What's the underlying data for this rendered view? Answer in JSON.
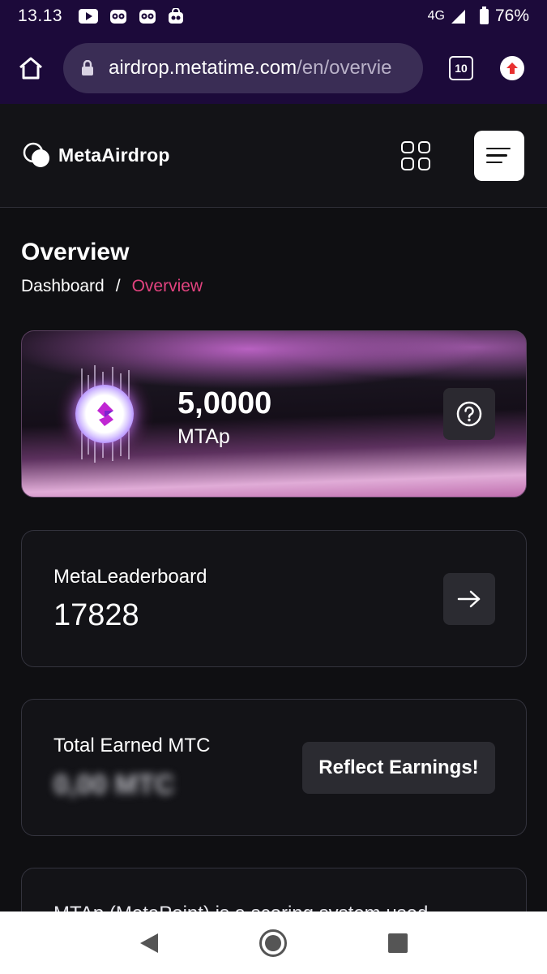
{
  "status_bar": {
    "time": "13.13",
    "network": "4G",
    "battery": "76%",
    "notification_icons": [
      "youtube-icon",
      "owl-icon",
      "owl-icon",
      "bag-icon"
    ]
  },
  "browser": {
    "url_domain": "airdrop.metatime.com",
    "url_path": "/en/overvie",
    "tab_count": "10"
  },
  "header": {
    "logo_text": "MetaAirdrop"
  },
  "page": {
    "title": "Overview",
    "breadcrumb": {
      "parent": "Dashboard",
      "separator": "/",
      "current": "Overview"
    }
  },
  "points_card": {
    "value": "5,0000",
    "unit": "MTAp"
  },
  "leaderboard_card": {
    "label": "MetaLeaderboard",
    "value": "17828"
  },
  "earned_card": {
    "label": "Total Earned MTC",
    "value": "0,00 MTC",
    "button_label": "Reflect Earnings!"
  },
  "info_card": {
    "text": "MTAp (MetaPoint) is a scoring system used"
  },
  "colors": {
    "accent": "#e2437f",
    "background": "#0f0f12",
    "browser_chrome": "#1c0a3a"
  }
}
